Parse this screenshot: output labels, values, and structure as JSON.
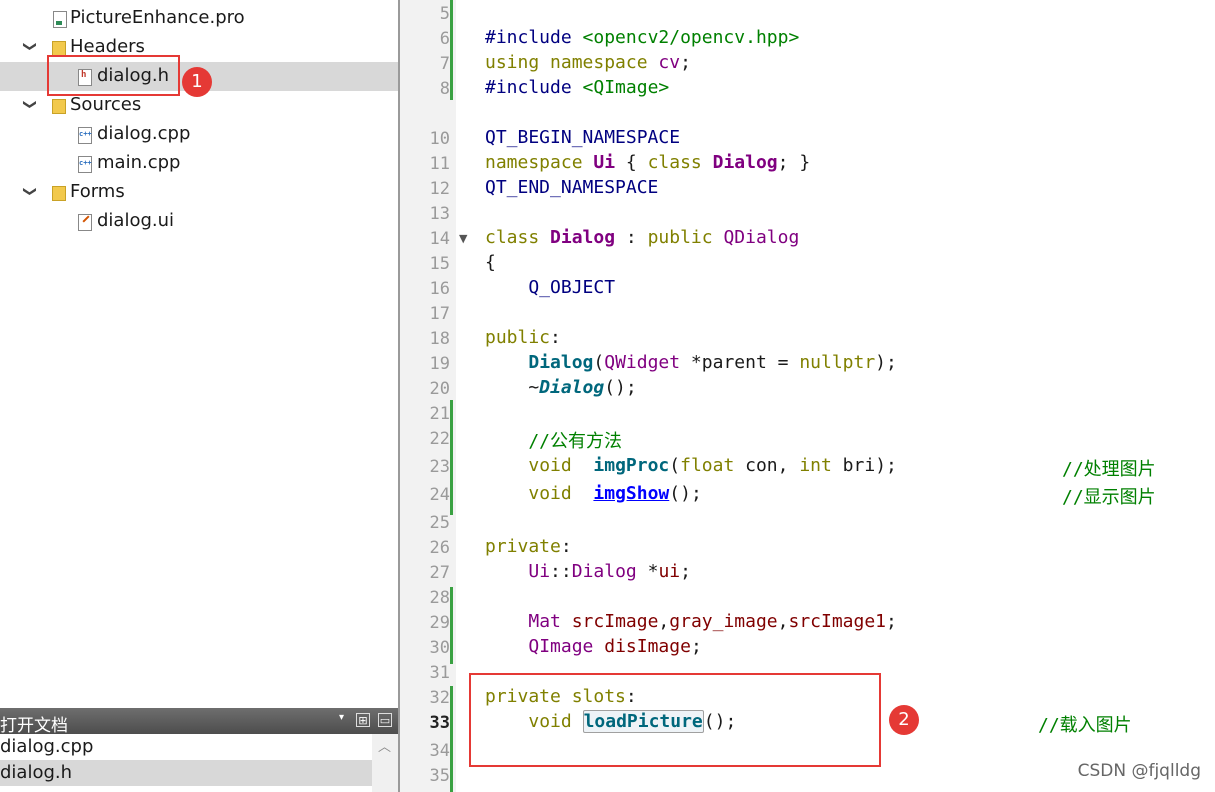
{
  "project_tree": {
    "items": [
      {
        "label": "PictureEnhance.pro",
        "icon": "pro-file-icon"
      },
      {
        "label": "Headers",
        "icon": "header-folder-icon",
        "expanded": true
      },
      {
        "label": "dialog.h",
        "icon": "header-file-icon",
        "selected": true
      },
      {
        "label": "Sources",
        "icon": "source-folder-icon",
        "expanded": true
      },
      {
        "label": "dialog.cpp",
        "icon": "cpp-file-icon"
      },
      {
        "label": "main.cpp",
        "icon": "cpp-file-icon"
      },
      {
        "label": "Forms",
        "icon": "forms-folder-icon",
        "expanded": true
      },
      {
        "label": "dialog.ui",
        "icon": "ui-file-icon"
      }
    ]
  },
  "open_docs": {
    "title": "打开文档",
    "items": [
      {
        "label": "dialog.cpp"
      },
      {
        "label": "dialog.h",
        "selected": true
      }
    ]
  },
  "annotations": {
    "badge1": "1",
    "badge2": "2"
  },
  "editor": {
    "current_line": "33",
    "lines": [
      {
        "n": "5"
      },
      {
        "n": "6"
      },
      {
        "n": "7"
      },
      {
        "n": "8"
      },
      {
        "n": "10"
      },
      {
        "n": "11"
      },
      {
        "n": "12"
      },
      {
        "n": "13"
      },
      {
        "n": "14"
      },
      {
        "n": "15"
      },
      {
        "n": "16"
      },
      {
        "n": "17"
      },
      {
        "n": "18"
      },
      {
        "n": "19"
      },
      {
        "n": "20"
      },
      {
        "n": "21"
      },
      {
        "n": "22"
      },
      {
        "n": "23"
      },
      {
        "n": "24"
      },
      {
        "n": "25"
      },
      {
        "n": "26"
      },
      {
        "n": "27"
      },
      {
        "n": "28"
      },
      {
        "n": "29"
      },
      {
        "n": "30"
      },
      {
        "n": "31"
      },
      {
        "n": "32"
      },
      {
        "n": "33"
      },
      {
        "n": "34"
      },
      {
        "n": "35"
      }
    ],
    "code": {
      "l6_a": "#include ",
      "l6_b": "<opencv2/opencv.hpp>",
      "l7_a": "using",
      "l7_b": " namespace ",
      "l7_c": "cv",
      "l7_d": ";",
      "l8_a": "#include ",
      "l8_b": "<QImage>",
      "l10": "QT_BEGIN_NAMESPACE",
      "l11_a": "namespace ",
      "l11_b": "Ui",
      "l11_c": " { ",
      "l11_d": "class ",
      "l11_e": "Dialog",
      "l11_f": "; }",
      "l12": "QT_END_NAMESPACE",
      "l14_a": "class ",
      "l14_b": "Dialog",
      "l14_c": " : ",
      "l14_d": "public ",
      "l14_e": "QDialog",
      "l15": "{",
      "l16": "    Q_OBJECT",
      "l18_a": "public",
      "l18_b": ":",
      "l19_a": "    ",
      "l19_b": "Dialog",
      "l19_c": "(",
      "l19_d": "QWidget",
      "l19_e": " *parent = ",
      "l19_f": "nullptr",
      "l19_g": ");",
      "l20_a": "    ~",
      "l20_b": "Dialog",
      "l20_c": "();",
      "l22": "    //公有方法",
      "l23_a": "    ",
      "l23_b": "void",
      "l23_c": "  ",
      "l23_d": "imgProc",
      "l23_e": "(",
      "l23_f": "float",
      "l23_g": " con, ",
      "l23_h": "int",
      "l23_i": " bri);",
      "l23_j": "//处理图片",
      "l24_a": "    ",
      "l24_b": "void",
      "l24_c": "  ",
      "l24_d": "imgShow",
      "l24_e": "();",
      "l24_f": "//显示图片",
      "l26_a": "private",
      "l26_b": ":",
      "l27_a": "    ",
      "l27_b": "Ui",
      "l27_c": "::",
      "l27_d": "Dialog",
      "l27_e": " *",
      "l27_f": "ui",
      "l27_g": ";",
      "l29_a": "    ",
      "l29_b": "Mat",
      "l29_c": " ",
      "l29_d": "srcImage",
      "l29_e": ",",
      "l29_f": "gray_image",
      "l29_g": ",",
      "l29_h": "srcImage1",
      "l29_i": ";",
      "l30_a": "    ",
      "l30_b": "QImage",
      "l30_c": " ",
      "l30_d": "disImage",
      "l30_e": ";",
      "l32_a": "private",
      "l32_b": " slots",
      "l32_c": ":",
      "l33_a": "    ",
      "l33_b": "void",
      "l33_c": " ",
      "l33_d": "loadPicture",
      "l33_e": "();",
      "l33_f": "//载入图片"
    }
  },
  "watermark": "CSDN @fjqlldg"
}
